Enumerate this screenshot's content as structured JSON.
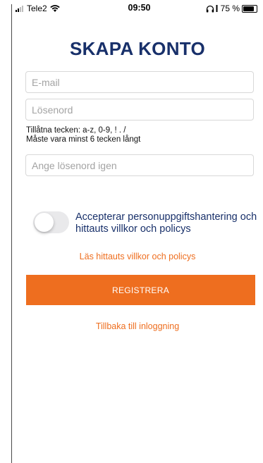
{
  "status_bar": {
    "carrier": "Tele2",
    "time": "09:50",
    "battery": "75 %",
    "battery_level": 0.75
  },
  "title": "SKAPA KONTO",
  "form": {
    "email_placeholder": "E-mail",
    "email_value": "",
    "password_placeholder": "Lösenord",
    "password_value": "",
    "hint_line1": "Tillåtna tecken: a-z, 0-9, ! . /",
    "hint_line2": "Måste vara minst 6 tecken långt",
    "password_repeat_placeholder": "Ange lösenord igen",
    "password_repeat_value": ""
  },
  "consent": {
    "toggle_on": false,
    "label": "Accepterar personuppgiftshantering och hittauts villkor och policys"
  },
  "links": {
    "terms": "Läs hittauts villkor och policys",
    "back_to_login": "Tillbaka till inloggning"
  },
  "buttons": {
    "register": "REGISTRERA"
  },
  "colors": {
    "accent": "#ee6e1f",
    "title": "#18306a"
  },
  "icons": {
    "signal": "cellular-signal-icon",
    "wifi": "wifi-icon",
    "headphones": "headphones-icon",
    "charging": "charging-icon",
    "battery": "battery-icon"
  }
}
